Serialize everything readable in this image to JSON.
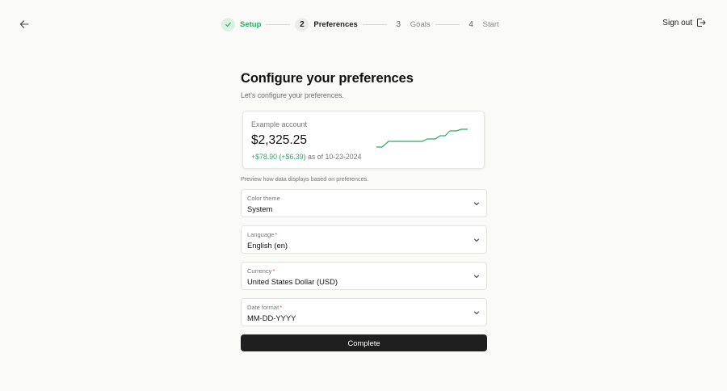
{
  "nav": {
    "back_icon": "arrow-left-icon",
    "signout_label": "Sign out",
    "signout_icon": "sign-out-icon"
  },
  "stepper": {
    "steps": [
      {
        "badge": "",
        "label": "Setup",
        "state": "done"
      },
      {
        "badge": "2",
        "label": "Preferences",
        "state": "current"
      },
      {
        "badge": "3",
        "label": "Goals",
        "state": "todo"
      },
      {
        "badge": "4",
        "label": "Start",
        "state": "todo"
      }
    ]
  },
  "page": {
    "title": "Configure your preferences",
    "subtitle": "Let's configure your preferences."
  },
  "preview": {
    "account_label": "Example account",
    "amount": "$2,325.25",
    "change": "+$78.90 (+$6.39)",
    "as_of": " as of 10-23-2024",
    "note": "Preview how data displays based on preferences.",
    "accent_color": "#2fa866"
  },
  "fields": [
    {
      "label": "Color theme",
      "required": false,
      "value": "System"
    },
    {
      "label": "Language",
      "required": true,
      "value": "English (en)"
    },
    {
      "label": "Currency",
      "required": true,
      "value": "United States Dollar (USD)"
    },
    {
      "label": "Date format",
      "required": true,
      "value": "MM-DD-YYYY"
    }
  ],
  "complete_label": "Complete"
}
